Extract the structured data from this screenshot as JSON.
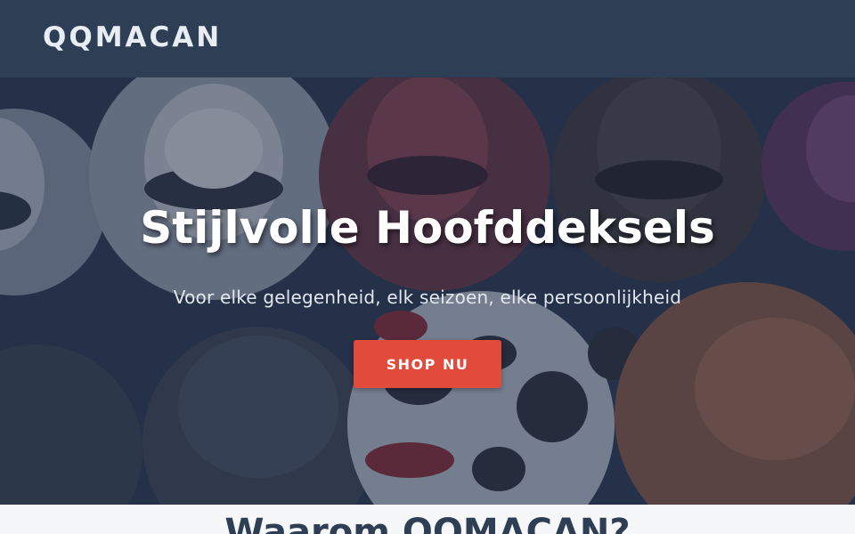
{
  "header": {
    "logo": "QQMACAN"
  },
  "hero": {
    "image": "hats-background",
    "title": "Stijlvolle Hoofddeksels",
    "subtitle": "Voor elke gelegenheid, elk seizoen, elke persoonlijkheid",
    "cta_label": "SHOP NU"
  },
  "section": {
    "title": "Waarom QQMACAN?"
  },
  "colors": {
    "header_bg": "#2e3e54",
    "cta_bg": "#e14b3b",
    "hero_overlay": "#1e2a40"
  }
}
